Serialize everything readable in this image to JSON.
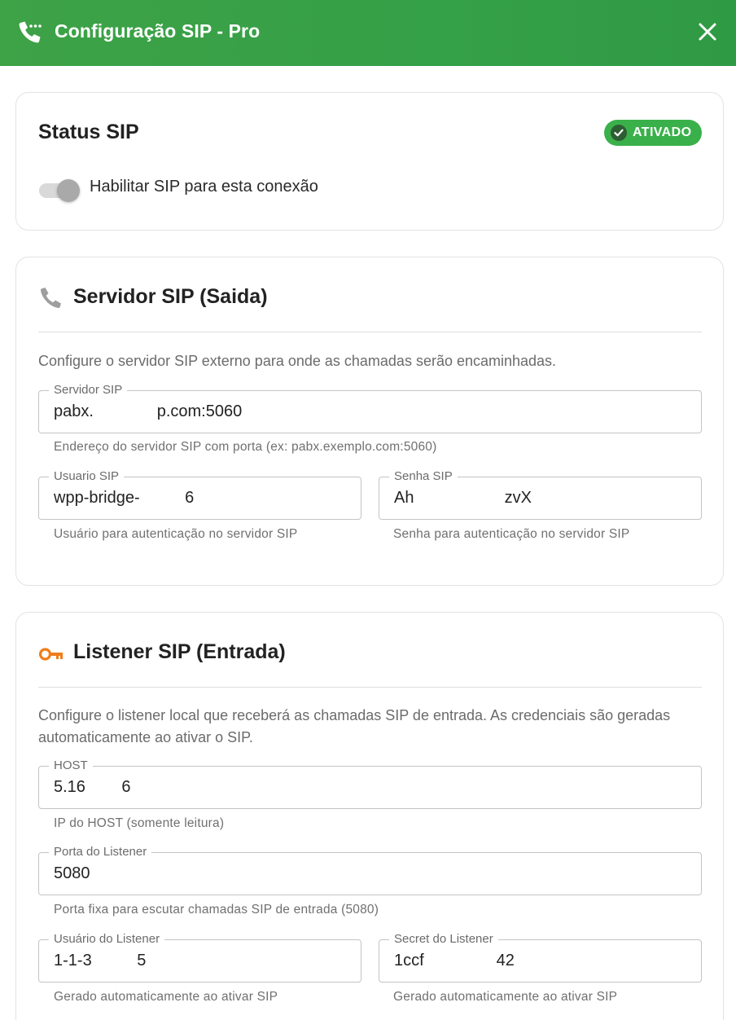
{
  "header": {
    "title": "Configuração SIP - Pro",
    "icon": "phone-dialing-icon",
    "close_icon": "close-icon"
  },
  "status_card": {
    "title": "Status SIP",
    "badge": "ATIVADO",
    "toggle_label": "Habilitar SIP para esta conexão",
    "toggle_on": true
  },
  "server_card": {
    "title": "Servidor SIP (Saida)",
    "icon": "phone-icon",
    "description": "Configure o servidor SIP externo para onde as chamadas serão encaminhadas.",
    "server": {
      "label": "Servidor SIP",
      "value": "pabx.              p.com:5060",
      "helper": "Endereço do servidor SIP com porta (ex: pabx.exemplo.com:5060)"
    },
    "user": {
      "label": "Usuario SIP",
      "value": "wpp-bridge-          6",
      "helper": "Usuário para autenticação no servidor SIP"
    },
    "password": {
      "label": "Senha SIP",
      "value": "Ah                    zvX",
      "helper": "Senha para autenticação no servidor SIP"
    }
  },
  "listener_card": {
    "title": "Listener SIP (Entrada)",
    "icon": "key-icon",
    "description": "Configure o listener local que receberá as chamadas SIP de entrada. As credenciais são geradas automaticamente ao ativar o SIP.",
    "host": {
      "label": "HOST",
      "value": "5.16        6",
      "helper": "IP do HOST (somente leitura)"
    },
    "port": {
      "label": "Porta do Listener",
      "value": "5080",
      "helper": "Porta fixa para escutar chamadas SIP de entrada (5080)"
    },
    "user": {
      "label": "Usuário do Listener",
      "value": "1-1-3          5",
      "helper": "Gerado automaticamente ao ativar SIP"
    },
    "secret": {
      "label": "Secret do Listener",
      "value": "1ccf                42",
      "helper": "Gerado automaticamente ao ativar SIP"
    }
  },
  "colors": {
    "header_green": "#34a047",
    "badge_green": "#3ab04a",
    "key_orange": "#ef7d1a"
  }
}
